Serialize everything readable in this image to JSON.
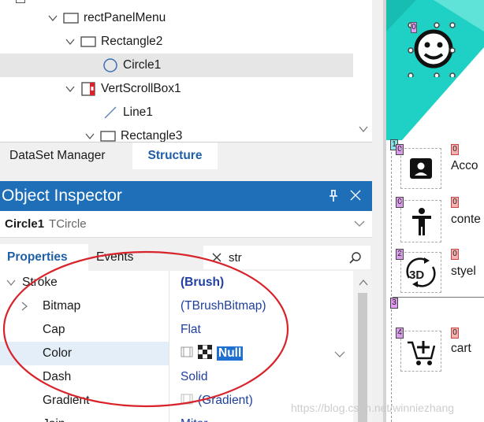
{
  "structure_tree": {
    "items": [
      {
        "label": "rectPanelMenu",
        "icon": "rectangle-icon",
        "expanded": true
      },
      {
        "label": "Rectangle2",
        "icon": "rectangle-icon",
        "expanded": true
      },
      {
        "label": "Circle1",
        "icon": "circle-icon",
        "selected": true
      },
      {
        "label": "VertScrollBox1",
        "icon": "vert-scrollbox-icon",
        "expanded": true
      },
      {
        "label": "Line1",
        "icon": "line-icon"
      },
      {
        "label": "Rectangle3",
        "icon": "rectangle-icon",
        "expanded": true
      }
    ]
  },
  "panel_tabs": {
    "dataset_manager": "DataSet Manager",
    "structure": "Structure"
  },
  "object_inspector": {
    "title": "Object Inspector",
    "object_name": "Circle1",
    "object_type": "TCircle",
    "tabs": {
      "properties": "Properties",
      "events": "Events"
    },
    "search": {
      "value": "str"
    },
    "properties": [
      {
        "name": "Stroke",
        "value": "(Brush)",
        "expanded": true,
        "bold_value": true
      },
      {
        "name": "Bitmap",
        "value": "(TBrushBitmap)",
        "expandable": true
      },
      {
        "name": "Cap",
        "value": "Flat"
      },
      {
        "name": "Color",
        "value": "Null",
        "selected": true,
        "editor": true
      },
      {
        "name": "Dash",
        "value": "Solid"
      },
      {
        "name": "Gradient",
        "value": "(Gradient)"
      },
      {
        "name": "Join",
        "value": "Miter"
      }
    ]
  },
  "canvas": {
    "badges": [
      "1",
      "0",
      "0",
      "0",
      "0",
      "2",
      "0",
      "3",
      "4",
      "0",
      "0"
    ],
    "list_items": [
      {
        "label": "Acco",
        "icon": "account-icon"
      },
      {
        "label": "conte",
        "icon": "accessibility-icon"
      },
      {
        "label": "styel",
        "icon": "rotate-3d-icon",
        "icon_text": "3D"
      },
      {
        "label": "cart",
        "icon": "add-cart-icon"
      }
    ]
  },
  "watermark": "https://blog.csdn.net/winniezhang",
  "colors": {
    "accent_blue": "#1e6fb8",
    "teal": "#1fd1c5",
    "annotation_red": "#d9232b"
  }
}
